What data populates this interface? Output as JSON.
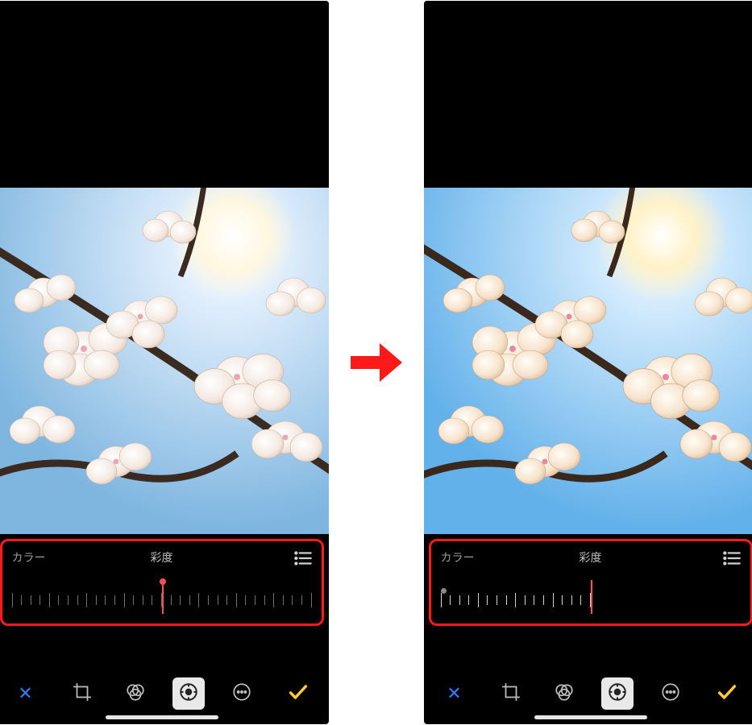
{
  "arrow_color": "#ff1a1a",
  "highlight_color": "#ff1a1a",
  "screens": {
    "left": {
      "panel": {
        "category_label": "カラー",
        "adjust_label": "彩度"
      },
      "slider": {
        "ticks": 33,
        "indicator_pos_pct": 50,
        "indicator_has_knob": true,
        "show_start_bead": false
      }
    },
    "right": {
      "panel": {
        "category_label": "カラー",
        "adjust_label": "彩度"
      },
      "slider": {
        "ticks": 33,
        "indicator_pos_pct": 50,
        "indicator_has_knob": false,
        "show_start_bead": true
      }
    }
  },
  "toolbar_icons": [
    "cancel",
    "crop",
    "filters",
    "adjust",
    "more",
    "confirm"
  ],
  "toolbar_active": "adjust"
}
